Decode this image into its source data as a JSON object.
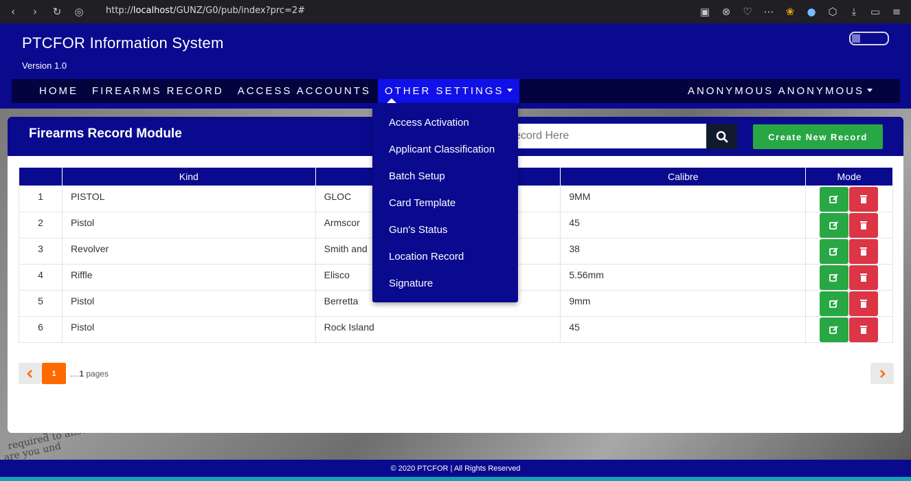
{
  "browser": {
    "url_prefix": "http://",
    "url_host": "localhost",
    "url_path": "/GUNZ/G0/pub/index?prc=2#"
  },
  "header": {
    "title": "PTCFOR Information System",
    "version": "Version 1.0"
  },
  "nav": {
    "home": "HOME",
    "firearms": "FIREARMS RECORD",
    "accounts": "ACCESS ACCOUNTS",
    "settings": "OTHER SETTINGS",
    "user": "ANONYMOUS ANONYMOUS"
  },
  "dropdown": {
    "items": [
      "Access Activation",
      "Applicant Classification",
      "Batch Setup",
      "Card Template",
      "Gun's Status",
      "Location Record",
      "Signature"
    ]
  },
  "module": {
    "title": "Firearms Record Module",
    "search_placeholder": "ecord Here",
    "create_label": "Create New Record"
  },
  "table": {
    "columns": [
      "",
      "Kind",
      "",
      "Calibre",
      "Mode"
    ],
    "rows": [
      [
        "1",
        "PISTOL",
        "GLOC",
        "9MM"
      ],
      [
        "2",
        "Pistol",
        "Armscor",
        "45"
      ],
      [
        "3",
        "Revolver",
        "Smith and",
        "38"
      ],
      [
        "4",
        "Riffle",
        "Elisco",
        "5.56mm"
      ],
      [
        "5",
        "Pistol",
        "Berretta",
        "9mm"
      ],
      [
        "6",
        "Pistol",
        "Rock Island",
        "45"
      ]
    ]
  },
  "pager": {
    "current": "1",
    "dots": "....",
    "total": "1",
    "suffix": " pages"
  },
  "footer": {
    "text": "© 2020 PTCFOR | All Rights Reserved"
  },
  "colors": {
    "primary": "#0a0a8f",
    "nav": "#03033f",
    "success": "#28a745",
    "danger": "#dc3545",
    "pager_active": "#ff6a00"
  }
}
